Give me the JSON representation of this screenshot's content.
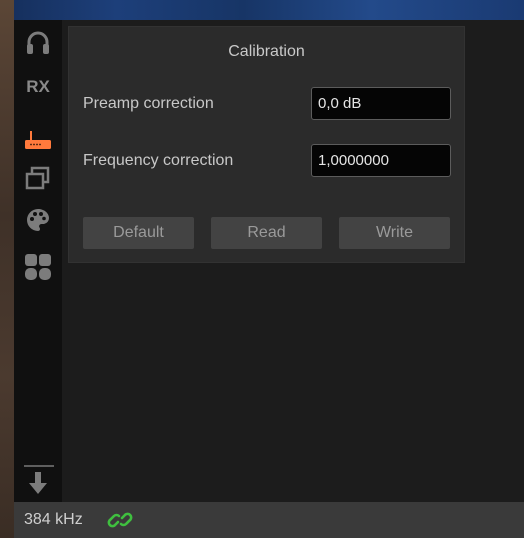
{
  "sidebar": {
    "rx_label": "RX"
  },
  "calibration": {
    "title": "Calibration",
    "preamp_label": "Preamp correction",
    "preamp_value": "0,0 dB",
    "freq_label": "Frequency correction",
    "freq_value": "1,0000000",
    "default_label": "Default",
    "read_label": "Read",
    "write_label": "Write"
  },
  "status": {
    "sample_rate": "384 kHz"
  },
  "colors": {
    "accent_device": "#ff7a3c",
    "link_green": "#3fbf3f"
  },
  "icons": [
    "headphones-icon",
    "device-icon",
    "windows-icon",
    "palette-icon",
    "apps-icon",
    "download-icon",
    "link-icon"
  ]
}
